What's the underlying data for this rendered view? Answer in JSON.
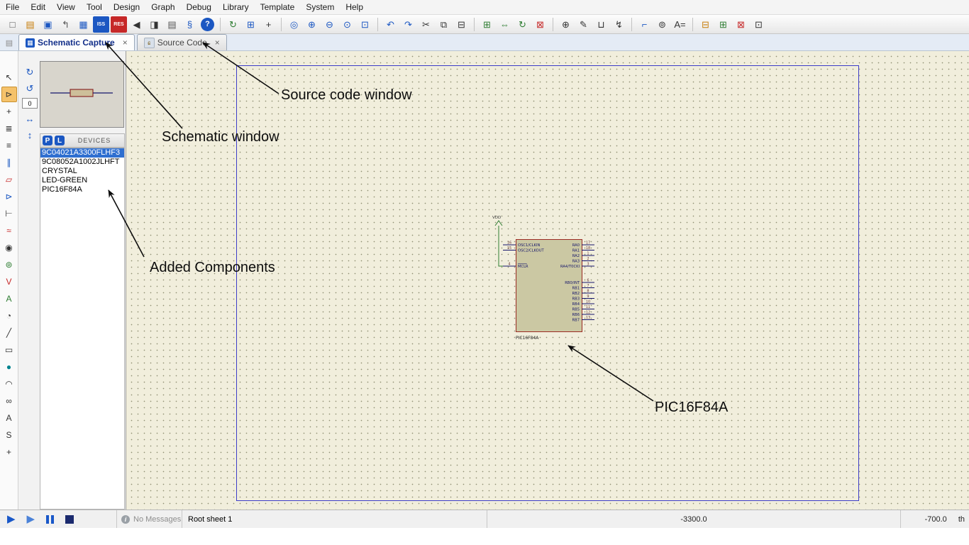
{
  "menu": {
    "items": [
      "File",
      "Edit",
      "View",
      "Tool",
      "Design",
      "Graph",
      "Debug",
      "Library",
      "Template",
      "System",
      "Help"
    ]
  },
  "toolbar": {
    "groups": [
      [
        {
          "n": "new-design",
          "g": "□",
          "c": "plain"
        },
        {
          "n": "open-design",
          "g": "▤",
          "c": "amber"
        },
        {
          "n": "save-design",
          "g": "▣",
          "c": "blue"
        },
        {
          "n": "import-section",
          "g": "↰",
          "c": "plain"
        },
        {
          "n": "schematic-capture-window",
          "g": "▦",
          "c": "blue"
        },
        {
          "n": "source-code-window",
          "g": "ISS",
          "c": "badge-blue"
        },
        {
          "n": "pcb-layout-window",
          "g": "RES",
          "c": "badge-red"
        },
        {
          "n": "audio-player",
          "g": "◀",
          "c": "dark"
        },
        {
          "n": "ic-tester",
          "g": "◨",
          "c": "dark"
        },
        {
          "n": "bill-of-materials",
          "g": "▤",
          "c": "plain"
        },
        {
          "n": "script-editor",
          "g": "§",
          "c": "blue"
        },
        {
          "n": "help",
          "g": "?",
          "c": "round-blue"
        }
      ],
      [
        {
          "n": "redraw-display",
          "g": "↻",
          "c": "green"
        },
        {
          "n": "toggle-grid",
          "g": "⊞",
          "c": "blue"
        },
        {
          "n": "false-origin",
          "g": "+",
          "c": "dark"
        }
      ],
      [
        {
          "n": "center-at-cursor",
          "g": "◎",
          "c": "blue"
        },
        {
          "n": "zoom-in",
          "g": "⊕",
          "c": "blue"
        },
        {
          "n": "zoom-out",
          "g": "⊖",
          "c": "blue"
        },
        {
          "n": "zoom-all",
          "g": "⊙",
          "c": "blue"
        },
        {
          "n": "zoom-area",
          "g": "⊡",
          "c": "blue"
        }
      ],
      [
        {
          "n": "undo",
          "g": "↶",
          "c": "blue"
        },
        {
          "n": "redo",
          "g": "↷",
          "c": "blue"
        },
        {
          "n": "cut",
          "g": "✂",
          "c": "dark"
        },
        {
          "n": "copy",
          "g": "⧉",
          "c": "dark"
        },
        {
          "n": "paste",
          "g": "⊟",
          "c": "dark"
        }
      ],
      [
        {
          "n": "block-copy",
          "g": "⊞",
          "c": "green"
        },
        {
          "n": "block-move",
          "g": "⇔",
          "c": "green"
        },
        {
          "n": "block-rotate",
          "g": "↻",
          "c": "green"
        },
        {
          "n": "block-delete",
          "g": "⊠",
          "c": "red"
        }
      ],
      [
        {
          "n": "pick-parts",
          "g": "⊕",
          "c": "dark"
        },
        {
          "n": "make-device",
          "g": "✎",
          "c": "dark"
        },
        {
          "n": "packaging-tool",
          "g": "⊔",
          "c": "dark"
        },
        {
          "n": "decompose",
          "g": "↯",
          "c": "dark"
        }
      ],
      [
        {
          "n": "wire-autorouter",
          "g": "⌐",
          "c": "blue"
        },
        {
          "n": "search-and-tag",
          "g": "⊚",
          "c": "dark"
        },
        {
          "n": "property-assignment-tool",
          "g": "A=",
          "c": "dark"
        }
      ],
      [
        {
          "n": "design-explorer",
          "g": "⊟",
          "c": "amber"
        },
        {
          "n": "new-root-sheet",
          "g": "⊞",
          "c": "green"
        },
        {
          "n": "remove-sheet",
          "g": "⊠",
          "c": "red"
        },
        {
          "n": "exit-to-parent-sheet",
          "g": "⊡",
          "c": "dark"
        }
      ]
    ]
  },
  "tabs": [
    {
      "label": "Schematic Capture",
      "close": "×",
      "active": true
    },
    {
      "label": "Source Code",
      "close": "×",
      "active": false
    }
  ],
  "left_tools": [
    {
      "n": "selection-mode",
      "g": "↖",
      "c": "dark"
    },
    {
      "n": "component-mode",
      "g": "⊳",
      "c": "dark",
      "sel": true
    },
    {
      "n": "junction-dot-mode",
      "g": "+",
      "c": "dark"
    },
    {
      "n": "wire-label-mode",
      "g": "≣",
      "c": "dark"
    },
    {
      "n": "text-script-mode",
      "g": "≡",
      "c": "dark"
    },
    {
      "n": "buses-mode",
      "g": "∥",
      "c": "blue"
    },
    {
      "n": "subcircuit-mode",
      "g": "▱",
      "c": "red"
    },
    {
      "n": "terminals-mode",
      "g": "⊳",
      "c": "blue"
    },
    {
      "n": "device-pins-mode",
      "g": "⊢",
      "c": "dark"
    },
    {
      "n": "graph-mode",
      "g": "≈",
      "c": "red"
    },
    {
      "n": "tape-recorder-mode",
      "g": "◉",
      "c": "dark"
    },
    {
      "n": "generator-mode",
      "g": "⊚",
      "c": "green"
    },
    {
      "n": "voltage-probe-mode",
      "g": "V",
      "c": "red"
    },
    {
      "n": "current-probe-mode",
      "g": "A",
      "c": "green"
    },
    {
      "n": "virtual-instruments-mode",
      "g": "◔",
      "c": "dark"
    },
    {
      "n": "2d-line-mode",
      "g": "╱",
      "c": "dark"
    },
    {
      "n": "2d-box-mode",
      "g": "▭",
      "c": "dark"
    },
    {
      "n": "2d-circle-mode",
      "g": "●",
      "c": "teal"
    },
    {
      "n": "2d-arc-mode",
      "g": "◠",
      "c": "dark"
    },
    {
      "n": "2d-path-mode",
      "g": "∞",
      "c": "dark"
    },
    {
      "n": "2d-text-mode",
      "g": "A",
      "c": "dark"
    },
    {
      "n": "2d-symbol-mode",
      "g": "S",
      "c": "dark"
    },
    {
      "n": "2d-marker-mode",
      "g": "+",
      "c": "dark"
    }
  ],
  "orientation": {
    "rotate_cw": "↻",
    "rotate_ccw": "↺",
    "angle": "0",
    "h_mirror": "↔",
    "v_mirror": "↕"
  },
  "object_selector": {
    "p": "P",
    "l": "L",
    "header": "DEVICES",
    "devices": [
      "9C04021A3300FLHF3",
      "9C08052A1002JLHFT",
      "CRYSTAL",
      "LED-GREEN",
      "PIC16F84A"
    ],
    "selected_index": 0
  },
  "schematic": {
    "chip": {
      "ref": "PIC16F84A",
      "power_label": "VDD",
      "body_fill": "#cbc8a3",
      "body_stroke": "#9b2a23",
      "left_pin_groups": [
        {
          "pins": [
            {
              "num": "16",
              "name": "OSC1/CLKIN"
            },
            {
              "num": "15",
              "name": "OSC2/CLKOUT"
            }
          ]
        },
        {
          "pins": [
            {
              "num": "4",
              "name": "MCLR",
              "overline": true
            }
          ]
        }
      ],
      "right_pin_groups": [
        {
          "pins": [
            {
              "num": "17",
              "name": "RA0"
            },
            {
              "num": "18",
              "name": "RA1"
            },
            {
              "num": "1",
              "name": "RA2"
            },
            {
              "num": "2",
              "name": "RA3"
            },
            {
              "num": "3",
              "name": "RA4/T0CKI"
            }
          ]
        },
        {
          "pins": [
            {
              "num": "6",
              "name": "RB0/INT"
            },
            {
              "num": "7",
              "name": "RB1"
            },
            {
              "num": "8",
              "name": "RB2"
            },
            {
              "num": "9",
              "name": "RB3"
            },
            {
              "num": "10",
              "name": "RB4"
            },
            {
              "num": "11",
              "name": "RB5"
            },
            {
              "num": "12",
              "name": "RB6"
            },
            {
              "num": "13",
              "name": "RB7"
            }
          ]
        }
      ]
    }
  },
  "annotations": [
    {
      "text": "Source code window"
    },
    {
      "text": "Schematic window"
    },
    {
      "text": "Added Components"
    },
    {
      "text": "PIC16F84A"
    }
  ],
  "statusbar": {
    "message": "No Messages",
    "sheet": "Root sheet 1",
    "coord_x": "-3300.0",
    "coord_y": "-700.0",
    "units": "th"
  }
}
